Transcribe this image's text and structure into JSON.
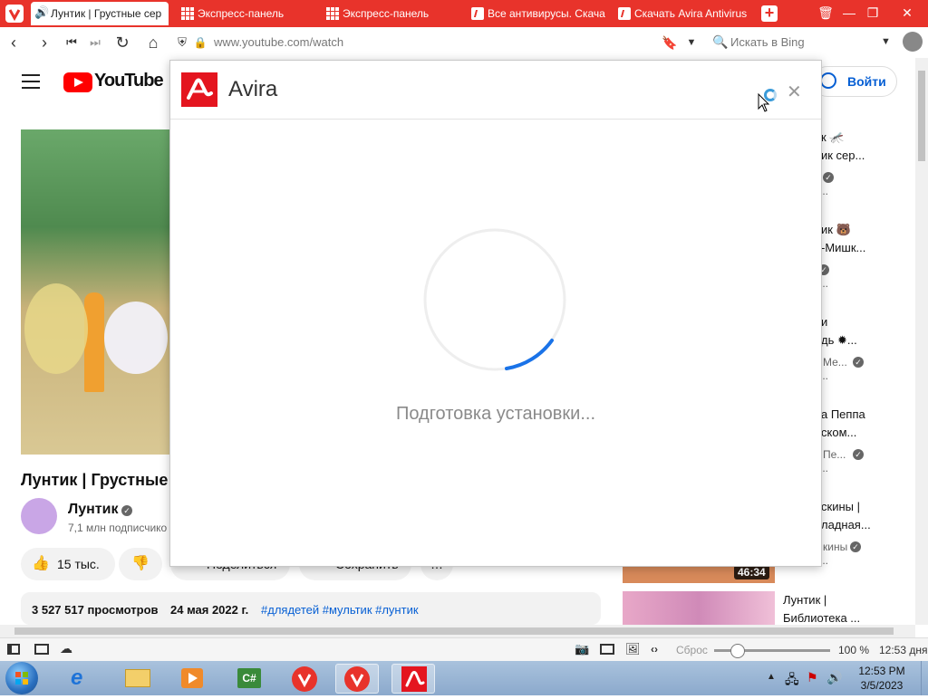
{
  "browser": {
    "tabs": [
      {
        "label": "Лунтик | Грустные сер",
        "active": true,
        "icon": "speaker-icon"
      },
      {
        "label": "Экспресс-панель",
        "active": false,
        "icon": "grid-icon"
      },
      {
        "label": "Экспресс-панель",
        "active": false,
        "icon": "grid-icon"
      },
      {
        "label": "Все антивирусы. Скача",
        "active": false,
        "icon": "avira-icon"
      },
      {
        "label": "Скачать Avira Antivirus",
        "active": false,
        "icon": "avira-icon"
      }
    ],
    "url": "www.youtube.com/watch",
    "search_placeholder": "Искать в Bing",
    "accent": "#e8332b"
  },
  "youtube": {
    "logo_text": "YouTube",
    "signin_label": "Войти",
    "video_title": "Лунтик | Грустные с",
    "channel_name": "Лунтик",
    "subscribers": "7,1 млн подписчико",
    "likes": "15 тыс.",
    "share_label": "Поделиться",
    "save_label": "Сохранить",
    "views": "3 527 517 просмотров",
    "date": "24 мая 2022 г.",
    "hashtags": "#длядетей #мультик #лунтик",
    "sidebar": [
      {
        "line1": "к 🦟",
        "line2": "ик сер...",
        "line3": "...",
        "channel": ""
      },
      {
        "line1": "ик 🐻",
        "line2": "-Мишк...",
        "line3": "...",
        "channel": ""
      },
      {
        "line1": "и",
        "line2": "дь ✹...",
        "line3": "...",
        "channel": "Ме..."
      },
      {
        "line1": "а Пеппа",
        "line2": "ском...",
        "line3": "...",
        "channel": "Пе..."
      },
      {
        "line1": "скины |",
        "line2": "ладная...",
        "line3": "...",
        "channel": "кины",
        "duration": "46:34"
      },
      {
        "line1": "Лунтик |",
        "line2": "Библиотека ...",
        "line3": "",
        "channel": ""
      }
    ]
  },
  "dialog": {
    "title": "Avira",
    "status": "Подготовка установки...",
    "brand_color": "#e4151f",
    "progress_arc_color": "#1a73e8"
  },
  "statusbar": {
    "reset_label": "Сброс",
    "zoom": "100 %",
    "time": "12:53 дня"
  },
  "taskbar": {
    "clock_time": "12:53 PM",
    "clock_date": "3/5/2023"
  }
}
